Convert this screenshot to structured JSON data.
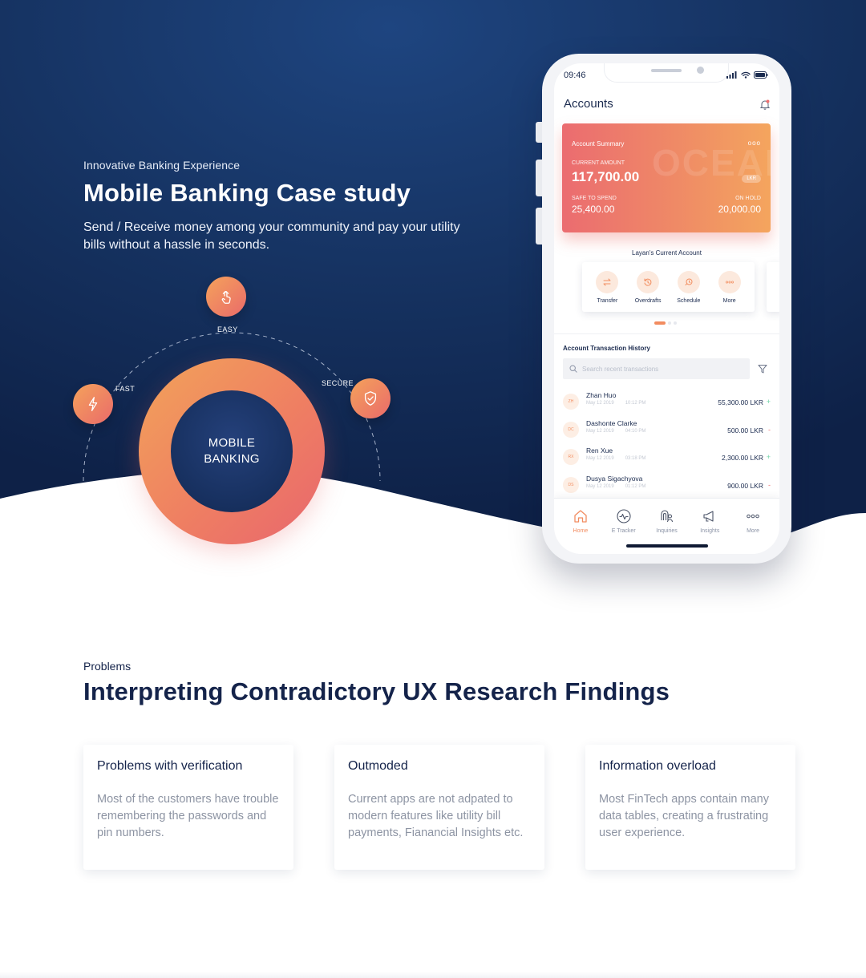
{
  "hero": {
    "eyebrow": "Innovative Banking Experience",
    "title": "Mobile Banking Case study",
    "subtitle": "Send / Receive money among your community and pay your utility bills without a hassle in seconds."
  },
  "orbit": {
    "center_line1": "MOBILE",
    "center_line2": "BANKING",
    "nodes": [
      {
        "label": "EASY",
        "icon": "touch-hand-icon"
      },
      {
        "label": "FAST",
        "icon": "lightning-icon"
      },
      {
        "label": "SECURE",
        "icon": "shield-check-icon"
      }
    ]
  },
  "phone": {
    "status_time": "09:46",
    "title": "Accounts",
    "summary": {
      "title": "Account Summary",
      "watermark": "OCEAN",
      "more": "ooo",
      "current_label": "CURRENT AMOUNT",
      "current_value": "117,700.00",
      "currency": "LKR",
      "safe_label": "SAFE TO SPEND",
      "safe_value": "25,400.00",
      "hold_label": "ON HOLD",
      "hold_value": "20,000.00"
    },
    "account_name": "Layan's Current Account",
    "actions": [
      {
        "label": "Transfer",
        "icon": "transfer-icon"
      },
      {
        "label": "Overdrafts",
        "icon": "history-icon"
      },
      {
        "label": "Schedule",
        "icon": "schedule-icon"
      },
      {
        "label": "More",
        "icon": "more-icon"
      }
    ],
    "history_title": "Account Transaction History",
    "search_placeholder": "Search recent transactions",
    "transactions": [
      {
        "initials": "ZH",
        "name": "Zhan Huo",
        "date": "May 12 2019",
        "time": "10:12 PM",
        "amount": "55,300.00 LKR",
        "sign": "+"
      },
      {
        "initials": "DC",
        "name": "Dashonte Clarke",
        "date": "May 12 2019",
        "time": "04:10 PM",
        "amount": "500.00 LKR",
        "sign": "-"
      },
      {
        "initials": "RX",
        "name": "Ren Xue",
        "date": "May 12 2019",
        "time": "03:18 PM",
        "amount": "2,300.00 LKR",
        "sign": "+"
      },
      {
        "initials": "DS",
        "name": "Dusya Sigachyova",
        "date": "May 12 2019",
        "time": "01:12 PM",
        "amount": "900.00 LKR",
        "sign": "-"
      }
    ],
    "tabs": [
      {
        "label": "Home",
        "icon": "home-icon",
        "active": true
      },
      {
        "label": "E Tracker",
        "icon": "pulse-icon",
        "active": false
      },
      {
        "label": "Inquiries",
        "icon": "inquiries-icon",
        "active": false
      },
      {
        "label": "Insights",
        "icon": "megaphone-icon",
        "active": false
      },
      {
        "label": "More",
        "icon": "more-icon",
        "active": false
      }
    ]
  },
  "problems": {
    "eyebrow": "Problems",
    "title": "Interpreting Contradictory UX Research Findings",
    "cards": [
      {
        "title": "Problems with verification",
        "body": "Most of the customers have trouble remembering the passwords and pin numbers."
      },
      {
        "title": "Outmoded",
        "body": "Current apps are not adpated to modern features like utility bill payments, Fianancial Insights etc."
      },
      {
        "title": "Information overload",
        "body": "Most FinTech apps contain many data tables, creating a frustrating user experience."
      }
    ]
  },
  "colors": {
    "navy": "#14234a",
    "hero_top": "#1c3d73",
    "hero_bottom": "#0f2349",
    "accent_orange": "#f4a25b",
    "accent_coral": "#ea6b6a",
    "positive": "#6fd3a7",
    "negative": "#f07070"
  }
}
